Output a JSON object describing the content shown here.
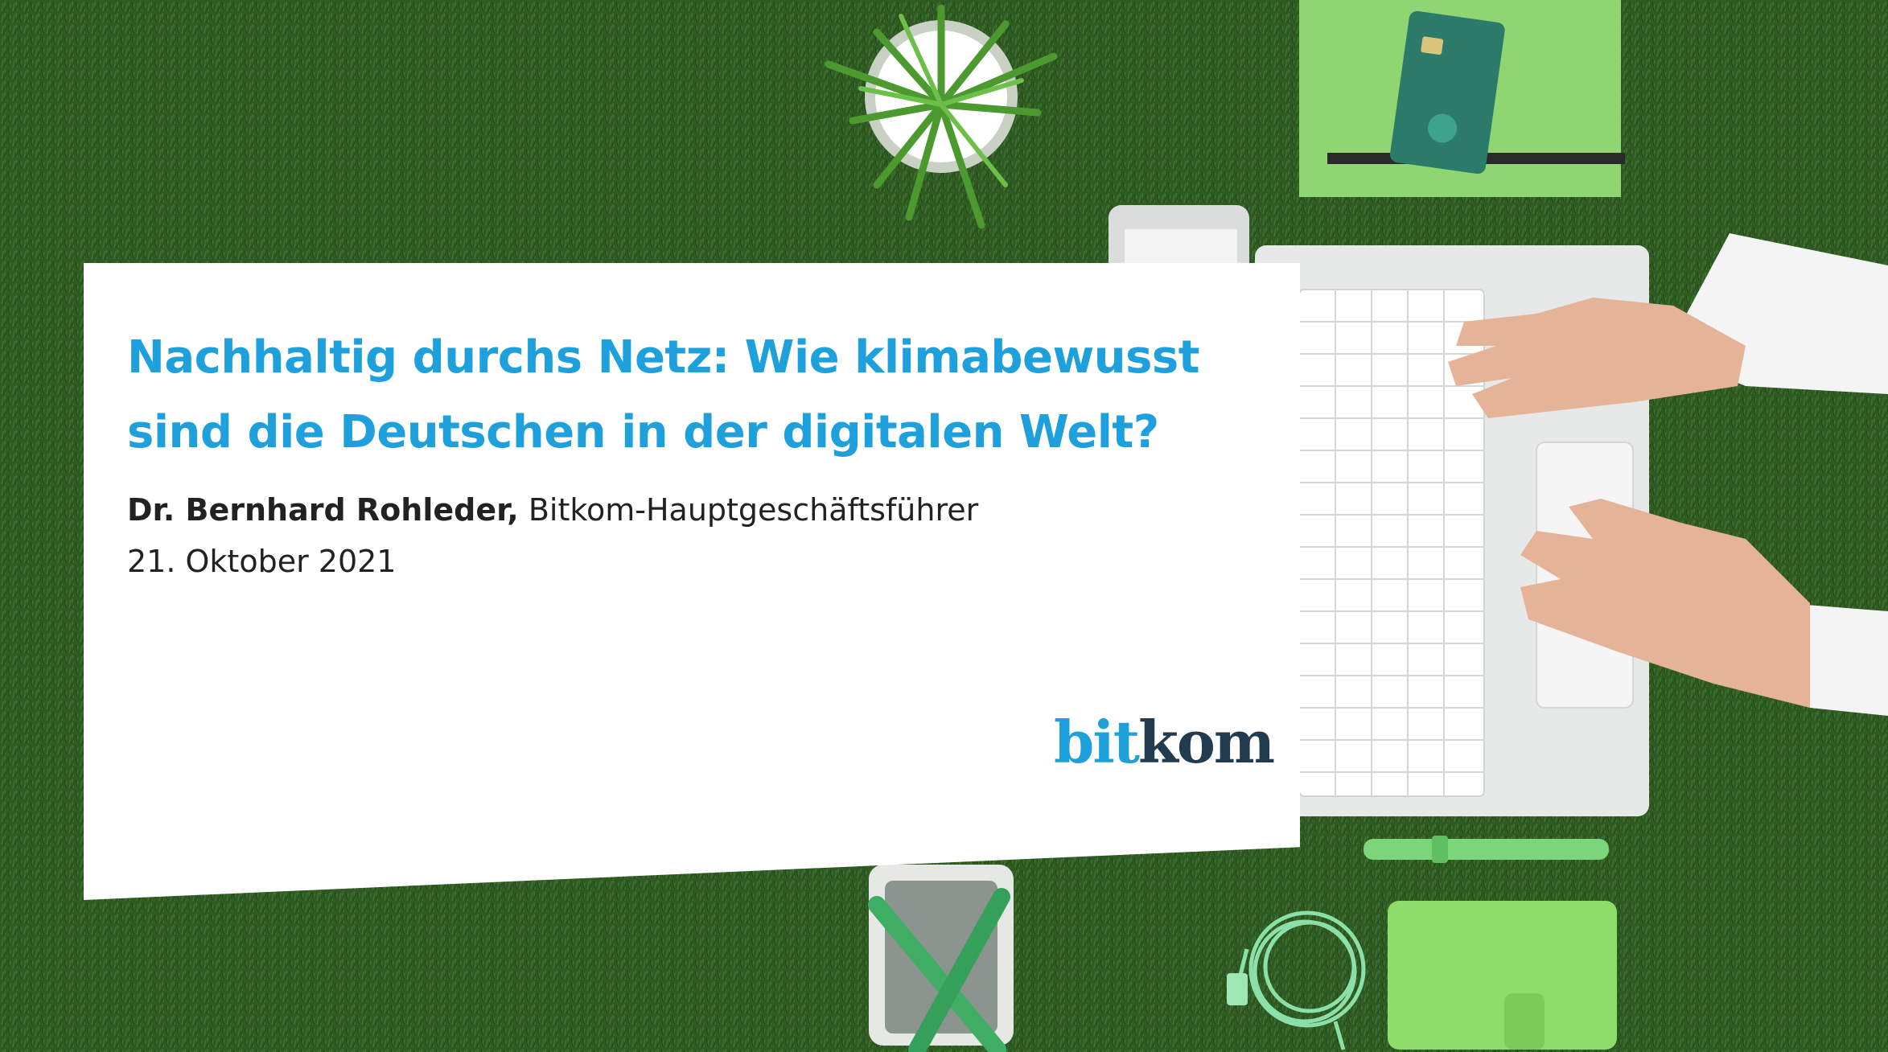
{
  "slide": {
    "title": "Nachhaltig durchs Netz: Wie klimabewusst sind die Deutschen in der digitalen Welt?",
    "speaker_name": "Dr. Bernhard Rohleder,",
    "speaker_role": "Bitkom-Hauptgeschäftsführer",
    "date": "21. Oktober 2021",
    "logo_part1": "bit",
    "logo_part2": "kom"
  },
  "background": {
    "objects": [
      "plant-icon",
      "notebook-icon",
      "credit-card-icon",
      "laptop-icon",
      "hands-icon",
      "pen-icon",
      "pen-holder-icon",
      "cable-icon",
      "phone-case-icon"
    ]
  },
  "colors": {
    "title": "#1ea0dc",
    "logo_bit": "#1ea0dc",
    "logo_kom": "#233b4f",
    "grass": "#2f5a22",
    "card": "#ffffff"
  }
}
